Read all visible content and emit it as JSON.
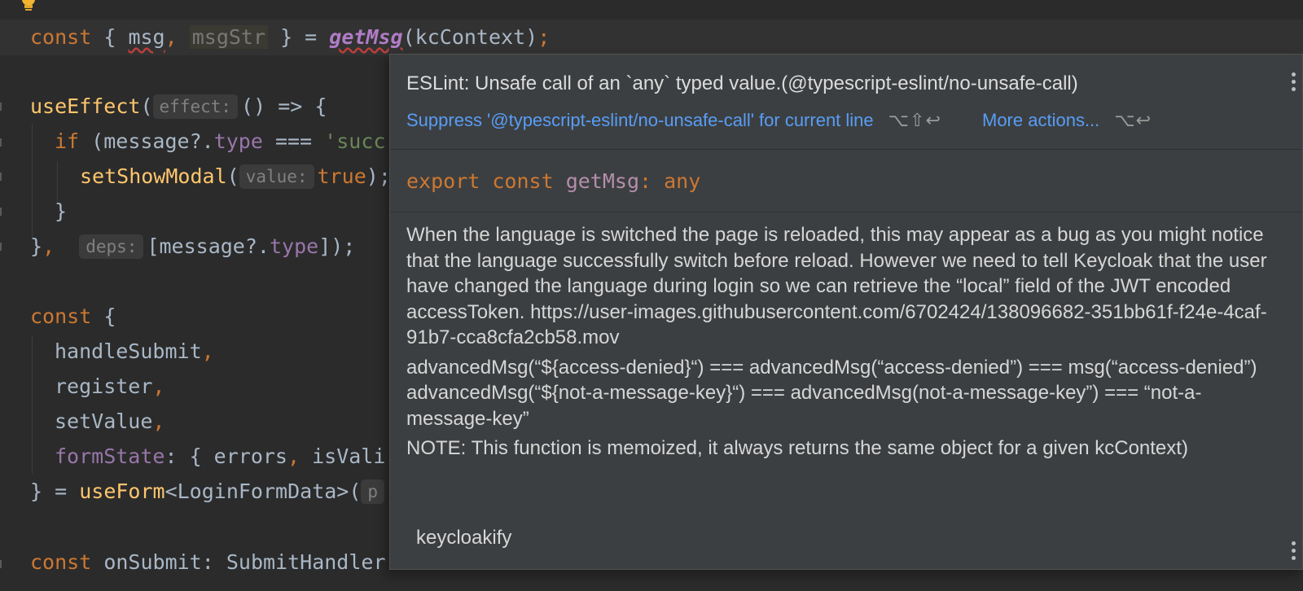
{
  "editor": {
    "line1": {
      "kw_const": "const",
      "open": "{ ",
      "msg": "msg",
      "comma": ",",
      "msgStr": "msgStr",
      "close": " } = ",
      "getMsg": "getMsg",
      "args": "(kcContext)",
      "semi": ";"
    },
    "line2": {
      "fn": "useEffect",
      "paren": "(",
      "hint": "effect:",
      "rest": "() => {"
    },
    "line3": {
      "kw_if": "if",
      "rest1": " (message?.",
      "prop": "type",
      "rest2": " === ",
      "str": "'succ"
    },
    "line4": {
      "fn": "setShowModal",
      "paren": "(",
      "hint": "value:",
      "val": "true",
      "rest": ");"
    },
    "line5": {
      "text": "}"
    },
    "line6": {
      "brace": "}",
      "comma": ",",
      "hint": "deps:",
      "rest1": "[message?.",
      "prop": "type",
      "rest2": "]);"
    },
    "line7": {
      "kw": "const",
      "rest": " {"
    },
    "line8": {
      "name": "handleSubmit",
      "comma": ","
    },
    "line9": {
      "name": "register",
      "comma": ","
    },
    "line10": {
      "name": "setValue",
      "comma": ","
    },
    "line11": {
      "prop": "formState",
      "rest1": ": { errors",
      "comma": ",",
      "rest2": " isVali"
    },
    "line12": {
      "rest1": "} = ",
      "fn": "useForm",
      "rest2": "<LoginFormData>(",
      "hint": "p"
    },
    "line13": {
      "kw": "const",
      "name": " onSubmit",
      "rest": ": SubmitHandler"
    }
  },
  "popup": {
    "title": "ESLint: Unsafe call of an `any` typed value.(@typescript-eslint/no-unsafe-call)",
    "suppress_link": "Suppress '@typescript-eslint/no-unsafe-call' for current line",
    "suppress_shortcut": "⌥⇧↩",
    "more_link": "More actions...",
    "more_shortcut": "⌥↩",
    "signature": {
      "kw": "export const",
      "name": "getMsg",
      "colon": ":",
      "type": "any"
    },
    "doc_p1": "When the language is switched the page is reloaded, this may appear as a bug as you might notice that the language successfully switch before reload. However we need to tell Keycloak that the user have changed the language during login so we can retrieve the “local” field of the JWT encoded accessToken. https://user-images.githubusercontent.com/6702424/138096682-351bb61f-f24e-4caf-91b7-cca8cfa2cb58.mov",
    "doc_p2": "advancedMsg(“${access-denied}“) === advancedMsg(“access-denied”) === msg(“access-denied”) advancedMsg(“${not-a-message-key}“) === advancedMsg(not-a-message-key”) === “not-a-message-key”",
    "doc_p3": "NOTE: This function is memoized, it always returns the same object for a given kcContext)",
    "footer": "keycloakify"
  },
  "colors": {
    "background": "#2b2b2b",
    "popup": "#3c3f41",
    "link": "#589df6",
    "keyword": "#cc7832",
    "function": "#ffc66d"
  }
}
